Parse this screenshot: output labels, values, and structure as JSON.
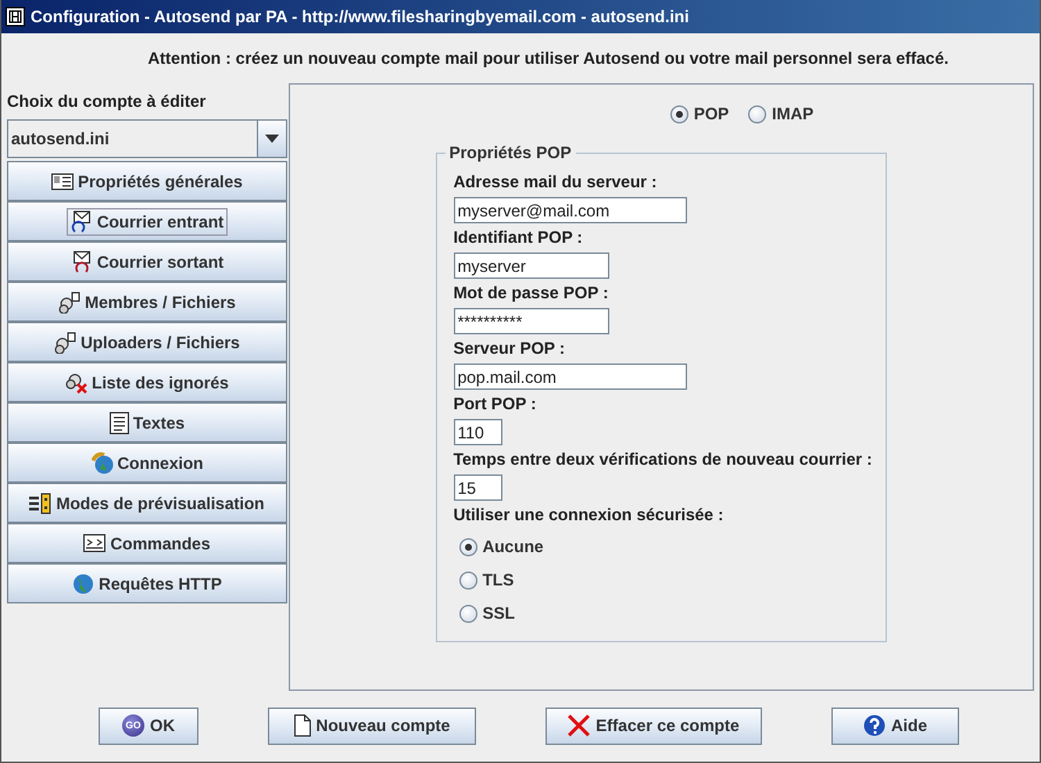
{
  "window": {
    "title": "Configuration - Autosend par PA - http://www.filesharingbyemail.com - autosend.ini"
  },
  "warning": "Attention : créez un nouveau compte mail pour utiliser Autosend ou votre mail personnel sera effacé.",
  "account_label": "Choix du compte à éditer",
  "account_combo": {
    "value": "autosend.ini"
  },
  "sections": [
    {
      "label": "Propriétés générales",
      "selected": false
    },
    {
      "label": "Courrier entrant",
      "selected": true
    },
    {
      "label": "Courrier sortant",
      "selected": false
    },
    {
      "label": "Membres / Fichiers",
      "selected": false
    },
    {
      "label": "Uploaders / Fichiers",
      "selected": false
    },
    {
      "label": "Liste des ignorés",
      "selected": false
    },
    {
      "label": "Textes",
      "selected": false
    },
    {
      "label": "Connexion",
      "selected": false
    },
    {
      "label": "Modes de prévisualisation",
      "selected": false
    },
    {
      "label": "Commandes",
      "selected": false
    },
    {
      "label": "Requêtes HTTP",
      "selected": false
    }
  ],
  "protocol": [
    {
      "label": "POP",
      "selected": true
    },
    {
      "label": "IMAP",
      "selected": false
    }
  ],
  "group": {
    "title": "Propriétés POP",
    "fields": [
      {
        "label": "Adresse mail du serveur :",
        "value": "myserver@mail.com"
      },
      {
        "label": "Identifiant POP :",
        "value": "myserver"
      },
      {
        "label": "Mot de passe POP :",
        "value": "**********"
      },
      {
        "label": "Serveur POP :",
        "value": "pop.mail.com"
      },
      {
        "label": "Port POP :",
        "value": "110"
      },
      {
        "label": "Temps entre deux vérifications de nouveau courrier :",
        "value": "15"
      }
    ],
    "security_label": "Utiliser une connexion sécurisée :",
    "security": [
      {
        "label": "Aucune",
        "selected": true
      },
      {
        "label": "TLS",
        "selected": false
      },
      {
        "label": "SSL",
        "selected": false
      }
    ]
  },
  "buttons": [
    {
      "label": "OK",
      "icon_text": "GO"
    },
    {
      "label": "Nouveau compte"
    },
    {
      "label": "Effacer ce compte"
    },
    {
      "label": "Aide"
    }
  ]
}
